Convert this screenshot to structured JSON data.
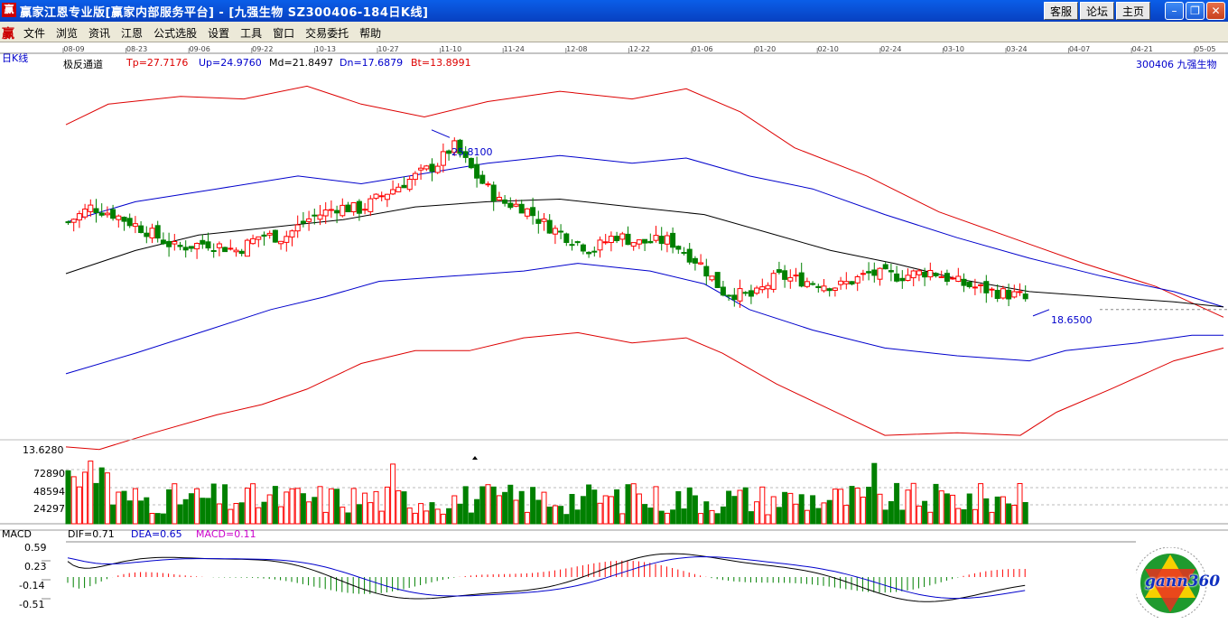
{
  "window": {
    "app_icon": "赢",
    "title": "赢家江恩专业版[赢家内部服务平台] - [九强生物  SZ300406-184日K线]",
    "buttons": [
      "客服",
      "论坛",
      "主页"
    ],
    "controls": [
      "minimize-icon",
      "restore-icon",
      "close-icon"
    ]
  },
  "menubar": {
    "logo": "赢",
    "items": [
      "文件",
      "浏览",
      "资讯",
      "江恩",
      "公式选股",
      "设置",
      "工具",
      "窗口",
      "交易委托",
      "帮助"
    ]
  },
  "date_axis": [
    "08-09",
    "08-23",
    "09-06",
    "09-22",
    "10-13",
    "10-27",
    "11-10",
    "11-24",
    "12-08",
    "12-22",
    "01-06",
    "01-20",
    "02-10",
    "02-24",
    "03-10",
    "03-24",
    "04-07",
    "04-21",
    "05-05"
  ],
  "main_pane": {
    "period_label": "日K线",
    "indicator_name": "极反通道",
    "tp": "Tp=27.7176",
    "up": "Up=24.9760",
    "md": "Md=21.8497",
    "dn": "Dn=17.6879",
    "bt": "Bt=13.8991",
    "stock": "300406 九强生物",
    "high_mark": "25.8100",
    "low_mark": "18.6500",
    "bottom_value": "13.6280"
  },
  "volume_pane": {
    "ticks": [
      "72890",
      "48594",
      "24297"
    ]
  },
  "macd_pane": {
    "name": "MACD",
    "dif": "DIF=0.71",
    "dea": "DEA=0.65",
    "macd": "MACD=0.11",
    "ticks": [
      "0.59",
      "0.23",
      "-0.14",
      "-0.51"
    ]
  },
  "logo": {
    "text": "gann360"
  },
  "colors": {
    "up_candle": "#ff0000",
    "down_candle": "#008000",
    "md_line": "#000000",
    "channel_inner": "#0000cc",
    "channel_outer": "#dd0000",
    "macd_pos": "#ff0000",
    "macd_neg": "#008000"
  },
  "chart_data": {
    "type": "candlestick",
    "dates": [
      "08-09",
      "08-23",
      "09-06",
      "09-22",
      "10-13",
      "10-27",
      "11-10",
      "11-24",
      "12-08",
      "12-22",
      "01-06",
      "01-20",
      "02-10",
      "02-24",
      "03-10",
      "03-24"
    ],
    "close_approx": [
      23.2,
      22.5,
      21.0,
      21.4,
      22.6,
      23.0,
      25.0,
      23.2,
      22.0,
      20.5,
      20.6,
      19.6,
      19.9,
      20.5,
      20.1,
      19.0
    ],
    "high": 25.81,
    "low": 18.65,
    "channel": {
      "tp": 27.7176,
      "up": 24.976,
      "md": 21.8497,
      "dn": 17.6879,
      "bt": 13.8991
    }
  }
}
